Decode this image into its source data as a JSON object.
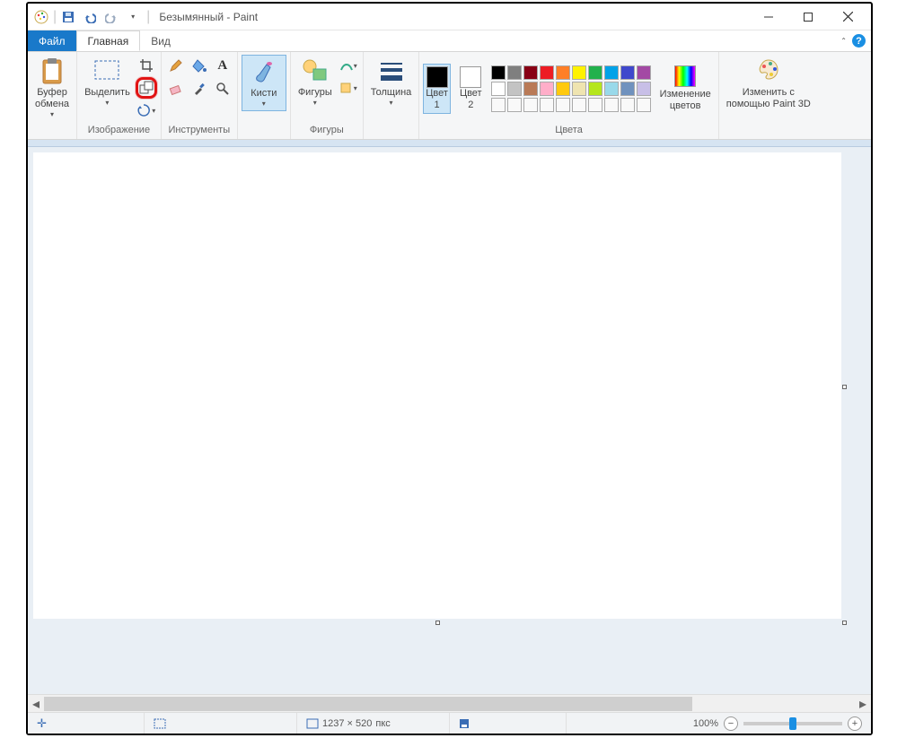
{
  "title": "Безымянный - Paint",
  "tabs": {
    "file": "Файл",
    "home": "Главная",
    "view": "Вид"
  },
  "groups": {
    "clipboard": {
      "label": "Буфер\nобмена",
      "section": ""
    },
    "image": {
      "select": "Выделить",
      "section": "Изображение"
    },
    "tools": {
      "section": "Инструменты"
    },
    "brushes": {
      "label": "Кисти"
    },
    "shapes": {
      "label": "Фигуры",
      "section": "Фигуры"
    },
    "size": {
      "label": "Толщина"
    },
    "colors": {
      "c1": "Цвет\n1",
      "c2": "Цвет\n2",
      "edit": "Изменение\nцветов",
      "section": "Цвета"
    },
    "paint3d": {
      "label": "Изменить с\nпомощью Paint 3D"
    }
  },
  "palette_row1": [
    "#000000",
    "#7f7f7f",
    "#880015",
    "#ed1c24",
    "#ff7f27",
    "#fff200",
    "#22b14c",
    "#00a2e8",
    "#3f48cc",
    "#a349a4"
  ],
  "palette_row2": [
    "#ffffff",
    "#c3c3c3",
    "#b97a57",
    "#ffaec9",
    "#ffc90e",
    "#efe4b0",
    "#b5e61d",
    "#99d9ea",
    "#7092be",
    "#c8bfe7"
  ],
  "color1": "#000000",
  "color2": "#ffffff",
  "status": {
    "cursor": "+",
    "dims_prefix": "1237 × 520",
    "dims_suffix": "пкс",
    "zoom": "100%"
  }
}
